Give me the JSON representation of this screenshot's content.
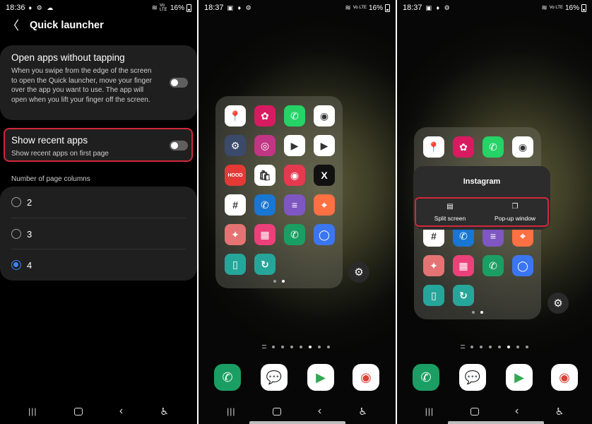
{
  "panel1": {
    "status": {
      "time": "18:36",
      "left_icons": "♦ ⚙ ☁",
      "battery": "16%",
      "signal": "Vo LTE"
    },
    "header": {
      "title": "Quick launcher"
    },
    "open_apps": {
      "title": "Open apps without tapping",
      "description": "When you swipe from the edge of the screen to open the Quick launcher, move your finger over the app you want to use. The app will open when you lift your finger off the screen."
    },
    "recent_apps": {
      "title": "Show recent apps",
      "description": "Show recent apps on first page"
    },
    "columns_label": "Number of page columns",
    "columns": [
      {
        "label": "2",
        "selected": false
      },
      {
        "label": "3",
        "selected": false
      },
      {
        "label": "4",
        "selected": true
      }
    ]
  },
  "panel2": {
    "status": {
      "time": "18:37",
      "battery": "16%"
    }
  },
  "panel3": {
    "status": {
      "time": "18:37",
      "battery": "16%"
    },
    "popup": {
      "title": "Instagram",
      "options": [
        {
          "label": "Split screen",
          "icon": "split-screen-icon"
        },
        {
          "label": "Pop-up window",
          "icon": "popup-window-icon"
        }
      ]
    }
  },
  "nav": {
    "recent": "|||",
    "home": "",
    "back": "<",
    "accessibility": "accessibility-icon"
  },
  "launcher_apps": [
    {
      "name": "Maps",
      "icon": "maps-icon",
      "color": "#ffffff",
      "glyph": "📍"
    },
    {
      "name": "Flower",
      "icon": "flower-icon",
      "color": "#d81b60",
      "glyph": "✿"
    },
    {
      "name": "WhatsApp",
      "icon": "whatsapp-icon",
      "color": "#25d366",
      "glyph": "✆"
    },
    {
      "name": "Chrome",
      "icon": "chrome-icon",
      "color": "#ffffff",
      "glyph": "◉"
    },
    {
      "name": "Settings",
      "icon": "settings-icon",
      "color": "#3b4a6b",
      "glyph": "⚙"
    },
    {
      "name": "Instagram",
      "icon": "instagram-icon",
      "color": "#c13584",
      "glyph": "◎"
    },
    {
      "name": "Play Store",
      "icon": "play-store-icon",
      "color": "#ffffff",
      "glyph": "▶"
    },
    {
      "name": "YouTube",
      "icon": "youtube-icon",
      "color": "#ffffff",
      "glyph": "▶"
    },
    {
      "name": "Hood",
      "icon": "hood-icon",
      "color": "#e53935",
      "glyph": "HOOD"
    },
    {
      "name": "Store",
      "icon": "store-icon",
      "color": "#ffffff",
      "glyph": "🛍"
    },
    {
      "name": "Camera",
      "icon": "camera-icon",
      "color": "#e53950",
      "glyph": "◉"
    },
    {
      "name": "X",
      "icon": "x-icon",
      "color": "#111111",
      "glyph": "X"
    },
    {
      "name": "Slack",
      "icon": "slack-icon",
      "color": "#ffffff",
      "glyph": "#"
    },
    {
      "name": "Phone",
      "icon": "phone-icon",
      "color": "#1976d2",
      "glyph": "✆"
    },
    {
      "name": "Equalizer",
      "icon": "equalizer-icon",
      "color": "#7e57c2",
      "glyph": "≡"
    },
    {
      "name": "Swiggy",
      "icon": "swiggy-icon",
      "color": "#ff7043",
      "glyph": "⌖"
    },
    {
      "name": "Gallery",
      "icon": "gallery-icon",
      "color": "#e57373",
      "glyph": "✦"
    },
    {
      "name": "Grid",
      "icon": "grid-icon",
      "color": "#ec407a",
      "glyph": "▦"
    },
    {
      "name": "Call",
      "icon": "call-icon",
      "color": "#1b9e63",
      "glyph": "✆"
    },
    {
      "name": "Signal",
      "icon": "signal-icon",
      "color": "#3a76f0",
      "glyph": "◯"
    },
    {
      "name": "Reader",
      "icon": "reader-icon",
      "color": "#26a69a",
      "glyph": "▯"
    },
    {
      "name": "Refresh",
      "icon": "refresh-icon",
      "color": "#26a69a",
      "glyph": "↻"
    }
  ],
  "dock": [
    {
      "name": "Phone",
      "icon": "phone-icon",
      "color": "#1b9e63",
      "glyph": "✆",
      "fg": "#ffffff"
    },
    {
      "name": "Messages",
      "icon": "messages-icon",
      "color": "#ffffff",
      "glyph": "💬",
      "fg": "#1a73e8"
    },
    {
      "name": "Play Store",
      "icon": "play-store-icon",
      "color": "#ffffff",
      "glyph": "▶",
      "fg": "#34a853"
    },
    {
      "name": "Chrome",
      "icon": "chrome-icon",
      "color": "#ffffff",
      "glyph": "◉",
      "fg": "#db4437"
    }
  ]
}
